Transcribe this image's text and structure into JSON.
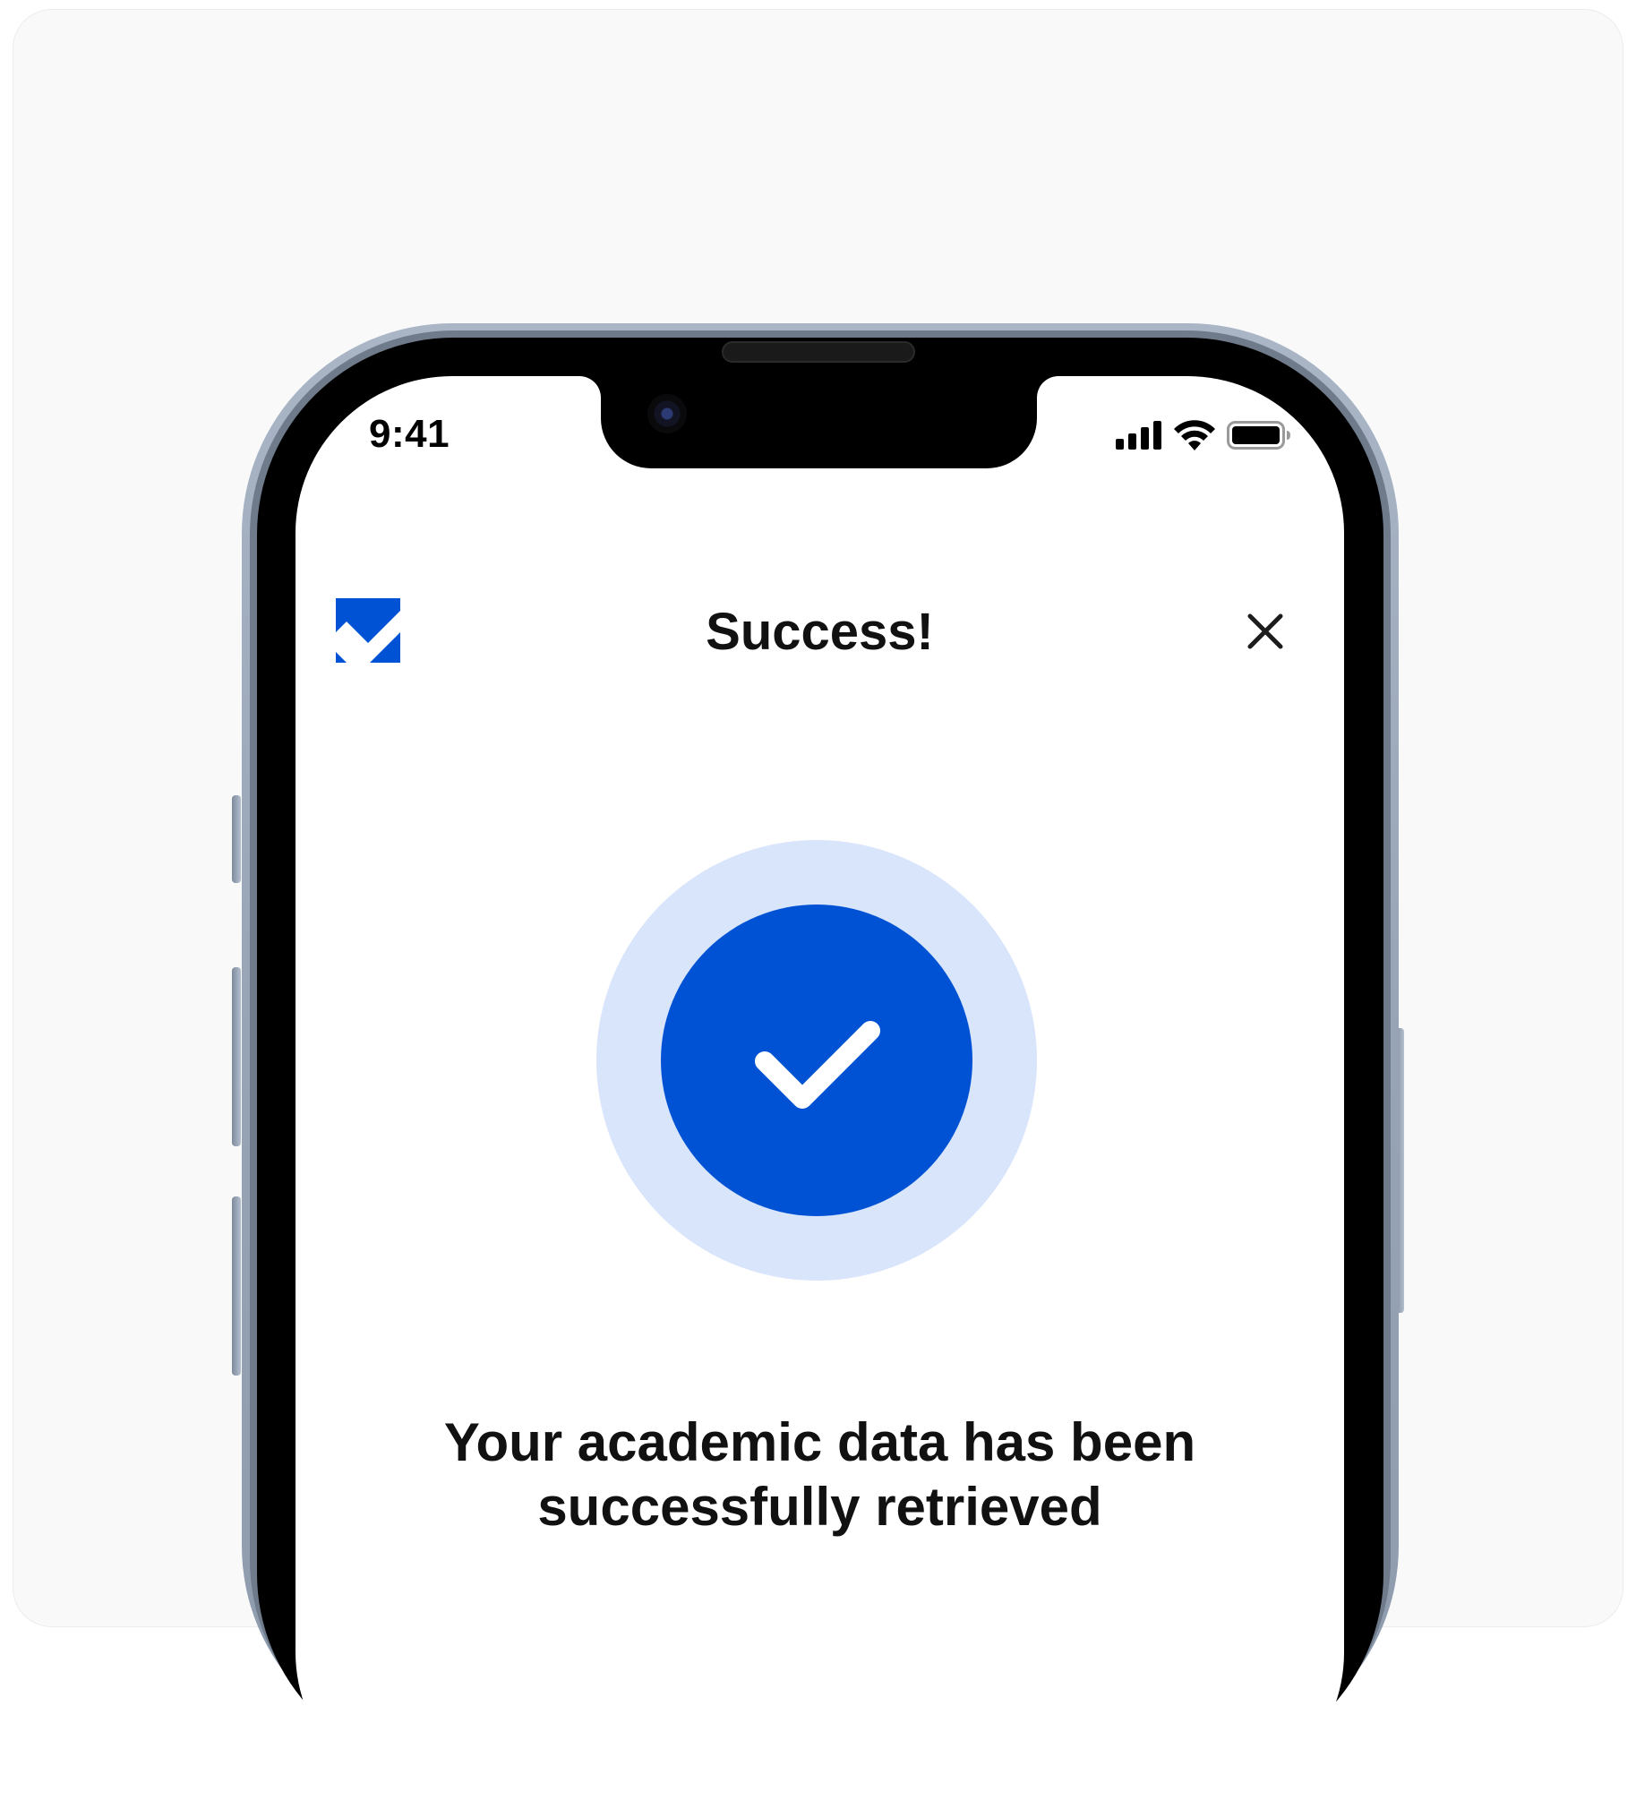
{
  "status_bar": {
    "time": "9:41",
    "icons": [
      "cellular-signal-icon",
      "wifi-icon",
      "battery-icon"
    ]
  },
  "header": {
    "logo": "app-logo",
    "title": "Success!",
    "close_icon": "close-icon"
  },
  "main": {
    "badge_icon": "checkmark-icon",
    "message_line1": "Your academic data has been",
    "message_line2": "successfully retrieved"
  },
  "colors": {
    "accent": "#0052d4",
    "accent_light": "#d8e5fb",
    "background": "#f9f9fa"
  }
}
